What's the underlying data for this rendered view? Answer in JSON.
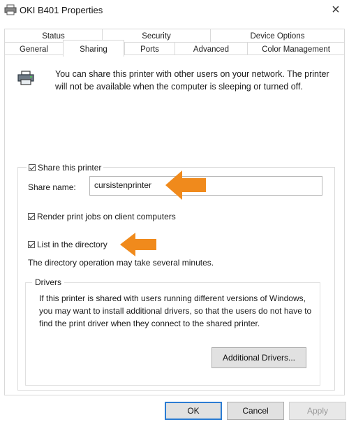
{
  "window": {
    "title": "OKI B401 Properties",
    "close_glyph": "×"
  },
  "tabs": {
    "top_row": [
      {
        "label": "Status"
      },
      {
        "label": "Security"
      },
      {
        "label": "Device Options"
      }
    ],
    "bottom_row": [
      {
        "label": "General"
      },
      {
        "label": "Sharing",
        "active": true
      },
      {
        "label": "Ports"
      },
      {
        "label": "Advanced"
      },
      {
        "label": "Color Management"
      }
    ]
  },
  "sharing": {
    "intro_text": "You can share this printer with other users on your network. The printer will not be available when the computer is sleeping or turned off.",
    "share_printer": {
      "label": "Share this printer",
      "checked": true
    },
    "share_name_label": "Share name:",
    "share_name_value": "cursistenprinter",
    "render_jobs": {
      "label": "Render print jobs on client computers",
      "checked": true
    },
    "list_directory": {
      "label": "List in the directory",
      "checked": true
    },
    "directory_note": "The directory operation may take several minutes.",
    "drivers": {
      "legend": "Drivers",
      "text": "If this printer is shared with users running different versions of Windows, you may want to install additional drivers, so that the users do not have to find the print driver when they connect to the shared printer.",
      "button_label": "Additional Drivers..."
    }
  },
  "buttons": {
    "ok": "OK",
    "cancel": "Cancel",
    "apply": "Apply"
  },
  "colors": {
    "annotation_arrow": "#f08a1c",
    "default_button_border": "#2b7cd3"
  },
  "icons": {
    "title": "printer-icon",
    "intro": "shared-printer-icon",
    "annotation": "orange-arrow-icon"
  }
}
